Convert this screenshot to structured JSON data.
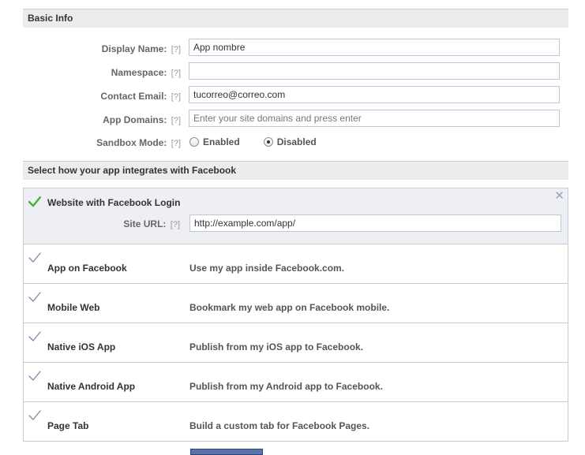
{
  "basic_info": {
    "header": "Basic Info",
    "help_marker": "[?]",
    "fields": [
      {
        "label": "Display Name:",
        "value": "App nombre",
        "placeholder": ""
      },
      {
        "label": "Namespace:",
        "value": "",
        "placeholder": ""
      },
      {
        "label": "Contact Email:",
        "value": "tucorreo@correo.com",
        "placeholder": ""
      },
      {
        "label": "App Domains:",
        "value": "",
        "placeholder": "Enter your site domains and press enter"
      }
    ],
    "sandbox": {
      "label": "Sandbox Mode:",
      "options": [
        "Enabled",
        "Disabled"
      ],
      "selected": "Disabled"
    }
  },
  "integration": {
    "header": "Select how your app integrates with Facebook",
    "website": {
      "title": "Website with Facebook Login",
      "site_url_label": "Site URL:",
      "site_url_value": "http://example.com/app/",
      "close_icon": "close-icon",
      "state": "selected"
    },
    "options": [
      {
        "title": "App on Facebook",
        "description": "Use my app inside Facebook.com."
      },
      {
        "title": "Mobile Web",
        "description": "Bookmark my web app on Facebook mobile."
      },
      {
        "title": "Native iOS App",
        "description": "Publish from my iOS app to Facebook."
      },
      {
        "title": "Native Android App",
        "description": "Publish from my Android app to Facebook."
      },
      {
        "title": "Page Tab",
        "description": "Build a custom tab for Facebook Pages."
      }
    ]
  },
  "colors": {
    "selected_check": "#4cae3a",
    "unselected_check": "#7a8aa6",
    "button_blue": "#5b74a8"
  }
}
